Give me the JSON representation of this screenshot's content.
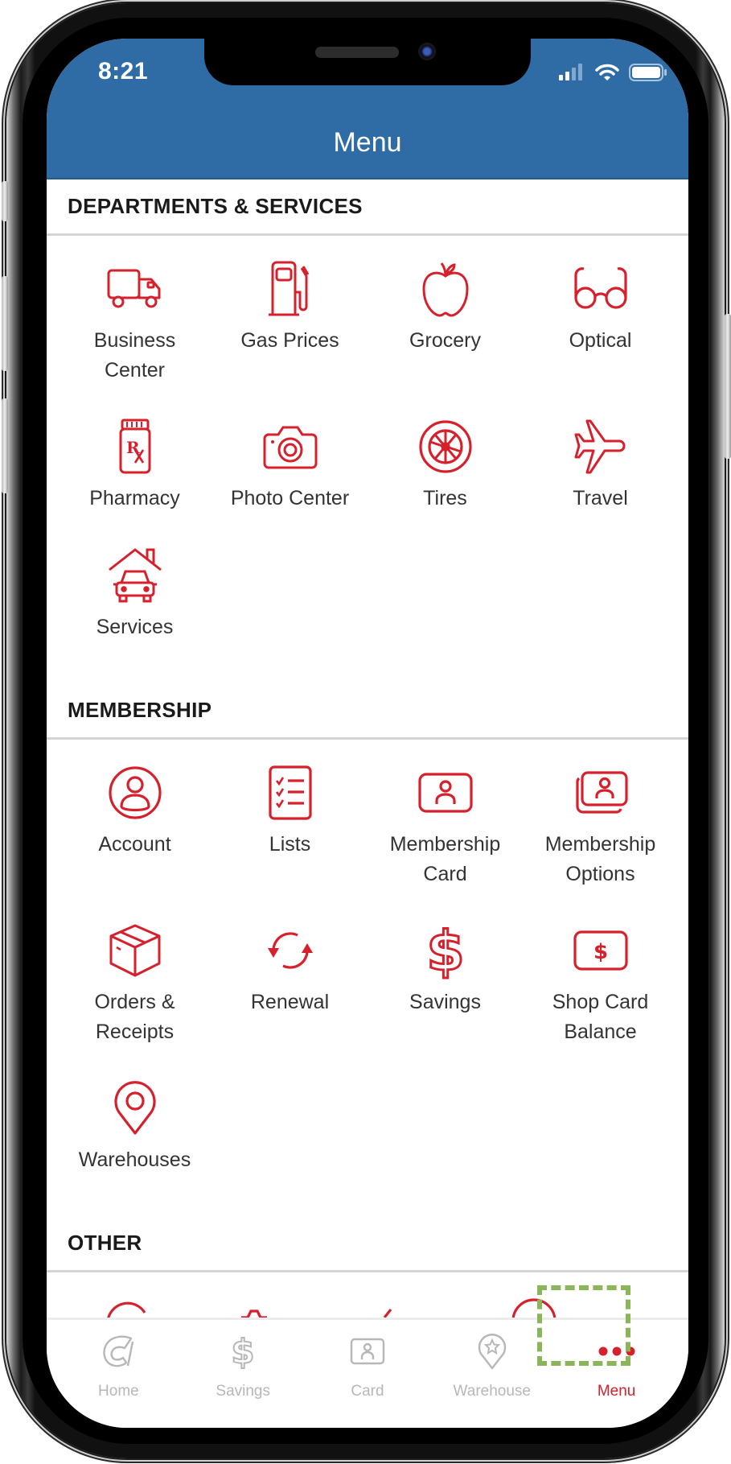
{
  "status_bar": {
    "time": "8:21",
    "icons": [
      "cellular-signal-icon",
      "wifi-icon",
      "battery-icon"
    ]
  },
  "header": {
    "title": "Menu"
  },
  "accent_colors": {
    "header_bg": "#2f6ca6",
    "icon_red": "#d6202c",
    "tab_inactive": "#b7b7b7",
    "highlight": "#8bb55a"
  },
  "sections": [
    {
      "title": "DEPARTMENTS & SERVICES",
      "items": [
        {
          "label": "Business Center",
          "icon": "truck-icon"
        },
        {
          "label": "Gas Prices",
          "icon": "gas-pump-icon"
        },
        {
          "label": "Grocery",
          "icon": "apple-icon"
        },
        {
          "label": "Optical",
          "icon": "glasses-icon"
        },
        {
          "label": "Pharmacy",
          "icon": "rx-bottle-icon"
        },
        {
          "label": "Photo Center",
          "icon": "camera-icon"
        },
        {
          "label": "Tires",
          "icon": "tire-icon"
        },
        {
          "label": "Travel",
          "icon": "airplane-icon"
        },
        {
          "label": "Services",
          "icon": "house-car-icon"
        }
      ]
    },
    {
      "title": "MEMBERSHIP",
      "items": [
        {
          "label": "Account",
          "icon": "user-circle-icon"
        },
        {
          "label": "Lists",
          "icon": "checklist-icon"
        },
        {
          "label": "Membership Card",
          "icon": "id-card-icon"
        },
        {
          "label": "Membership Options",
          "icon": "id-cards-stack-icon"
        },
        {
          "label": "Orders & Receipts",
          "icon": "box-icon"
        },
        {
          "label": "Renewal",
          "icon": "refresh-icon"
        },
        {
          "label": "Savings",
          "icon": "dollar-icon"
        },
        {
          "label": "Shop Card Balance",
          "icon": "dollar-card-icon"
        },
        {
          "label": "Warehouses",
          "icon": "map-pin-icon"
        }
      ]
    },
    {
      "title": "OTHER",
      "items": []
    }
  ],
  "tabbar": {
    "tabs": [
      {
        "label": "Home",
        "icon": "home-logo-icon",
        "active": false
      },
      {
        "label": "Savings",
        "icon": "dollar-icon",
        "active": false
      },
      {
        "label": "Card",
        "icon": "id-card-icon",
        "active": false
      },
      {
        "label": "Warehouse",
        "icon": "map-pin-star-icon",
        "active": false
      },
      {
        "label": "Menu",
        "icon": "more-dots-icon",
        "active": true
      }
    ]
  }
}
